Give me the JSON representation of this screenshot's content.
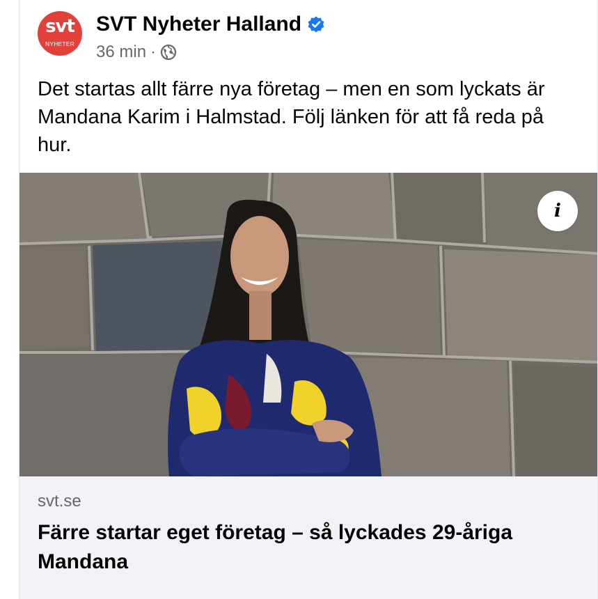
{
  "post": {
    "page_name": "SVT Nyheter Halland",
    "verified": true,
    "avatar": {
      "brand_text": "svt",
      "sub_text": "NYHETER",
      "color": "#e3403a"
    },
    "time": "36 min",
    "separator": "·",
    "audience_icon": "globe-icon",
    "text": "Det startas allt färre nya företag – men en som lyckats är Mandana Karim i Halmstad. Följ länken för att få reda på hur."
  },
  "image": {
    "info_icon": "info-icon",
    "info_glyph": "i"
  },
  "link_preview": {
    "domain": "svt.se",
    "title": "Färre startar eget företag – så lyckades 29-åriga Mandana"
  },
  "colors": {
    "text_primary": "#050505",
    "text_secondary": "#65676b",
    "verified_blue": "#1877f2",
    "preview_background": "#f0f2f5"
  }
}
